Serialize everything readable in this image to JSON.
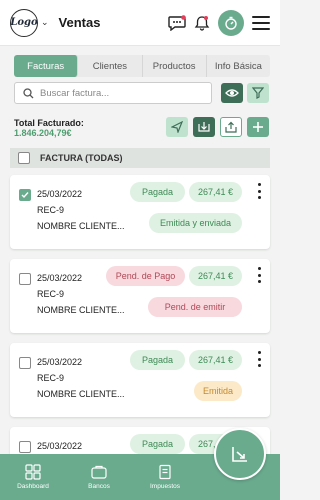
{
  "header": {
    "logo_text": "Logo",
    "title": "Ventas",
    "icons": [
      "chat-icon",
      "bell-icon",
      "timer-icon",
      "menu-icon"
    ]
  },
  "tabs": [
    {
      "label": "Facturas",
      "active": true
    },
    {
      "label": "Clientes",
      "active": false
    },
    {
      "label": "Productos",
      "active": false
    },
    {
      "label": "Info Básica",
      "active": false
    }
  ],
  "search": {
    "placeholder": "Buscar factura...",
    "value": ""
  },
  "summary": {
    "total_label": "Total Facturado:",
    "total_value": "1.846.204,79€"
  },
  "list_header": {
    "label": "FACTURA (TODAS)"
  },
  "invoices": [
    {
      "checked": true,
      "date": "25/03/2022",
      "ref": "REC-9",
      "client": "NOMBRE CLIENTE...",
      "status": "Pagada",
      "amount": "267,41 €",
      "state": "Emitida y enviada"
    },
    {
      "checked": false,
      "date": "25/03/2022",
      "ref": "REC-9",
      "client": "NOMBRE CLIENTE...",
      "status": "Pend. de Pago",
      "amount": "267,41 €",
      "state": "Pend. de emitir"
    },
    {
      "checked": false,
      "date": "25/03/2022",
      "ref": "REC-9",
      "client": "NOMBRE CLIENTE...",
      "status": "Pagada",
      "amount": "267,41 €",
      "state": "Emitida"
    },
    {
      "checked": false,
      "date": "25/03/2022",
      "status": "Pagada",
      "amount": "267,41 €"
    }
  ],
  "bottom_nav": [
    {
      "label": "Dashboard",
      "icon": "dashboard-icon"
    },
    {
      "label": "Bancos",
      "icon": "bank-icon"
    },
    {
      "label": "Impuestos",
      "icon": "tax-icon"
    }
  ],
  "colors": {
    "primary": "#6aab8e",
    "primary_dark": "#3f6e58",
    "primary_light": "#bfe2cf",
    "badge_green": "#dff1e2",
    "badge_pink": "#f7d9de",
    "badge_yellow": "#fbe9c7"
  }
}
